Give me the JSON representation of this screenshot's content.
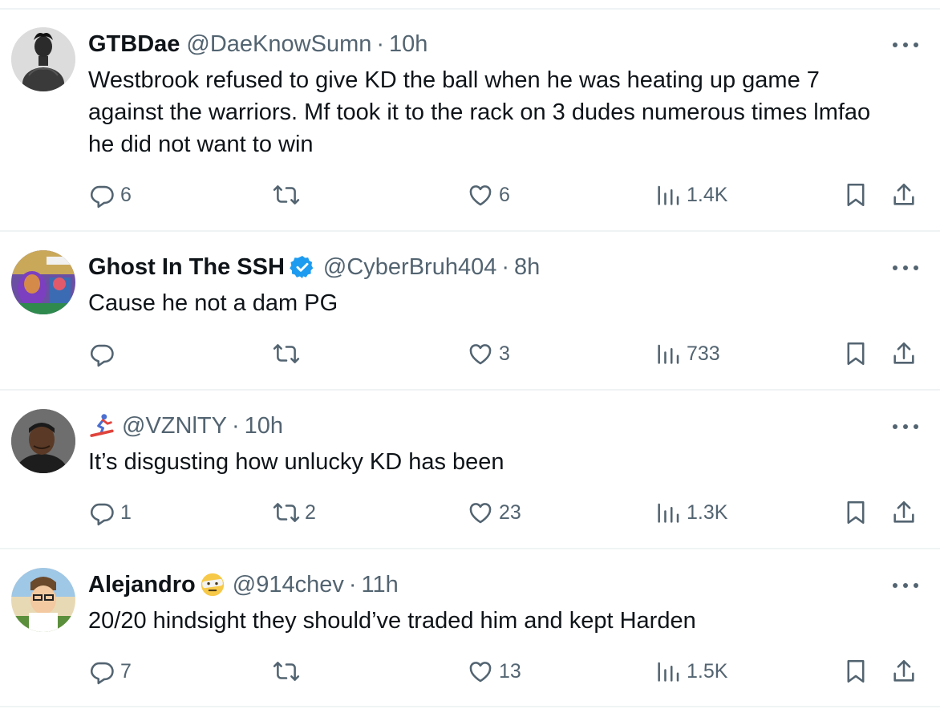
{
  "tweets": [
    {
      "name": "GTBDae",
      "handle": "@DaeKnowSumn",
      "time": "10h",
      "text": "Westbrook refused to give KD the ball when he was heating up game 7 against the warriors. Mf took it to the rack on 3 dudes numerous times lmfao he did not want to win",
      "replies": "6",
      "retweets": "",
      "likes": "6",
      "views": "1.4K",
      "verified": false,
      "name_emoji": ""
    },
    {
      "name": "Ghost In The SSH",
      "handle": "@CyberBruh404",
      "time": "8h",
      "text": "Cause he not a dam PG",
      "replies": "",
      "retweets": "",
      "likes": "3",
      "views": "733",
      "verified": true,
      "name_emoji": ""
    },
    {
      "name": "",
      "handle": "@VZNlTY",
      "time": "10h",
      "text": "It’s disgusting how unlucky KD has been",
      "replies": "1",
      "retweets": "2",
      "likes": "23",
      "views": "1.3K",
      "verified": false,
      "name_emoji": "snowboarder-emoji"
    },
    {
      "name": "Alejandro",
      "handle": "@914chev",
      "time": "11h",
      "text": "20/20 hindsight they should’ve traded him and kept Harden",
      "replies": "7",
      "retweets": "",
      "likes": "13",
      "views": "1.5K",
      "verified": false,
      "name_emoji": "face-with-bandage-emoji"
    }
  ],
  "separator": "·",
  "icons": {
    "reply": "reply-icon",
    "retweet": "retweet-icon",
    "like": "heart-icon",
    "views": "views-icon",
    "bookmark": "bookmark-icon",
    "share": "share-icon",
    "more": "more-icon"
  },
  "colors": {
    "text": "#0f1419",
    "secondary": "#536471",
    "verified": "#1d9bf0",
    "divider": "#eff3f4"
  }
}
